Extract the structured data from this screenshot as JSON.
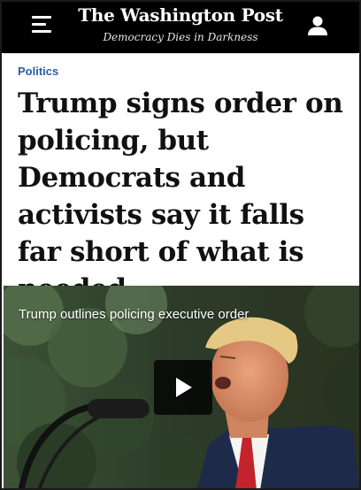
{
  "header": {
    "logo": "The Washington Post",
    "tagline": "Democracy Dies in Darkness",
    "menu_icon": "hamburger-menu-icon",
    "user_icon": "user-account-icon"
  },
  "article": {
    "kicker": "Politics",
    "headline": "Trump signs order on policing, but Democrats and activists say it falls far short of what is needed"
  },
  "video": {
    "caption": "Trump outlines policing executive order",
    "play_icon": "play-icon"
  },
  "colors": {
    "header_bg": "#000000",
    "kicker": "#2a5caa",
    "headline": "#111111"
  }
}
